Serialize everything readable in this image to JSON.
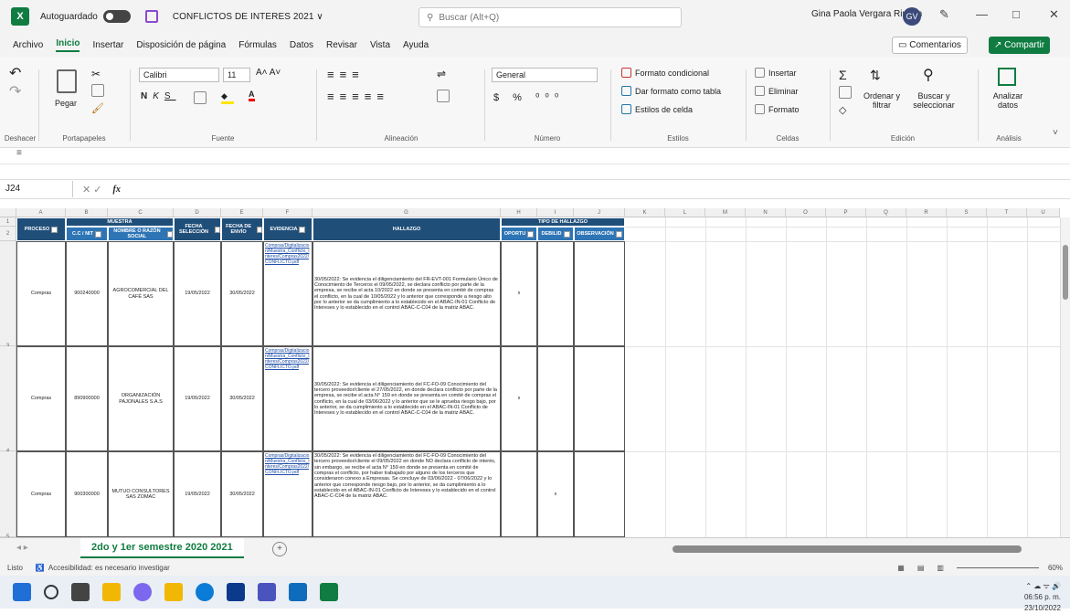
{
  "titlebar": {
    "autosave": "Autoguardado",
    "title": "CONFLICTOS DE INTERES 2021 ∨",
    "search": "Buscar (Alt+Q)",
    "user": "Gina Paola Vergara Rincon",
    "avatar": "GV",
    "minimize": "—",
    "maximize": "□",
    "close": "✕"
  },
  "menu": [
    "Archivo",
    "Inicio",
    "Insertar",
    "Disposición de página",
    "Fórmulas",
    "Datos",
    "Revisar",
    "Vista",
    "Ayuda"
  ],
  "menu_active": "Inicio",
  "buttons": {
    "comentarios": "Comentarios",
    "compartir": "Compartir"
  },
  "ribbon": {
    "deshacer": "Deshacer",
    "portapapeles": "Portapapeles",
    "pegar": "Pegar",
    "fuente": "Fuente",
    "font_name": "Calibri",
    "font_size": "11",
    "alineacion": "Alineación",
    "numero_format": "General",
    "numero": "Número",
    "formato_condicional": "Formato condicional",
    "dar_formato": "Dar formato como tabla",
    "estilos_celda": "Estilos de celda",
    "estilos": "Estilos",
    "insertar": "Insertar",
    "eliminar": "Eliminar",
    "formato": "Formato",
    "celdas": "Celdas",
    "ordenar": "Ordenar y filtrar",
    "buscar": "Buscar y seleccionar",
    "edicion": "Edición",
    "analizar": "Analizar datos",
    "analisis": "Análisis"
  },
  "formula_bar": {
    "namebox": "J24",
    "fx": "fx",
    "value": ""
  },
  "columns": [
    "A",
    "B",
    "C",
    "D",
    "E",
    "F",
    "G",
    "H",
    "I",
    "J",
    "K",
    "L",
    "M",
    "N",
    "O",
    "P",
    "Q",
    "R",
    "S",
    "T",
    "U"
  ],
  "table_header": {
    "muestra": "MUESTRA",
    "tipo_hallazgo": "TIPO DE HALLAZGO",
    "proceso": "PROCESO",
    "cc_nit": "C.C / NIT",
    "nombre": "NOMBRE O RAZÓN SOCIAL",
    "fecha_selec": "FECHA SELECCIÓN",
    "fecha_env": "FECHA DE ENVÍO",
    "evidencia": "EVIDENCIA",
    "hallazgo": "HALLAZGO",
    "oportunidad": "OPORTU",
    "debilidad": "DEBILID",
    "observacion": "OBSERVACIÓN"
  },
  "rows": [
    {
      "rownum": "3",
      "proceso": "Compras",
      "nit": "900240000",
      "nombre": "AGROCOMERCIAL DEL CAFÉ SAS",
      "fecha_selec": "19/05/2022",
      "fecha_env": "30/05/2022",
      "evidencia": "Compras/Digitalizacion/Muestra_Conflicto_Interes/Compras2022/CONFLICTO.pdf",
      "hallazgo": "30/05/2022: Se evidencia el diligenciamiento del FR-EVT-001 Formulario Único de Conocimiento de Terceros el 09/05/2022, se declara conflicto por parte de la empresa, se recibe el acta 10/2022 en donde se presenta en comité de compras el conflicto, en la cual de 10/05/2022 y lo anterior que corresponde a riesgo alto por lo anterior se da cumplimiento a lo establecido en el ABAC-IN-01 Conflicto de Intereses y lo establecido en el control ABAC-C-C04 de la matriz ABAC.",
      "x_col": "x",
      "x_pos": "oportunidad"
    },
    {
      "rownum": "4",
      "proceso": "Compras",
      "nit": "890900000",
      "nombre": "ORGANIZACIÓN PAJONALES S.A.S",
      "fecha_selec": "19/05/2022",
      "fecha_env": "30/05/2022",
      "evidencia": "Compras/Digitalizacion/Muestra_Conflicto_Interes/Compras2022/CONFLICTO.pdf",
      "hallazgo": "30/05/2022: Se evidencia el diligenciamiento del FC-FO-09 Conocimiento del tercero proveedor/cliente el 27/05/2022, en donde declara conflicto por parte de la empresa, se recibe el acta N° 159 en donde se presenta en comité de compras el conflicto, en la cual de 03/06/2022 y lo anterior que se le aprueba riesgo bajo, por lo anterior, se da cumplimiento a lo establecido en el ABAC-IN-01 Conflicto de Intereses y lo establecido en el control ABAC-C-C04 de la matriz ABAC.",
      "x_col": "x",
      "x_pos": "oportunidad"
    },
    {
      "rownum": "5",
      "proceso": "Compras",
      "nit": "900300000",
      "nombre": "MUTUO CONSULTORES SAS ZOMAC",
      "fecha_selec": "19/05/2022",
      "fecha_env": "30/05/2022",
      "evidencia": "Compras/Digitalizacion/Muestra_Conflicto_Interes/Compras2022/CONFLICTO.pdf",
      "hallazgo": "30/05/2022: Se evidencia el diligenciamiento del FC-FO-09 Conocimiento del tercero proveedor/cliente el 09/05/2022 en donde NO declara conflicto de interés, sin embargo, se recibe el acta N° 159 en donde se presenta en comité de compras el conflicto, por haber trabajado por alguno de los terceros que consideraron conexo a Empresas. Se concluye de 03/06/2022 - 07/06/2022 y lo anterior que corresponde riesgo bajo, por lo anterior, se da cumplimiento a lo establecido en el ABAC-IN-01 Conflicto de Intereses y lo establecido en el control ABAC-C-C04 de la matriz ABAC.",
      "x_col": "x",
      "x_pos": "debilidad"
    }
  ],
  "sheet_tab": "2do y 1er semestre 2020 2021",
  "add_sheet": "+",
  "status": {
    "ready": "Listo",
    "accessibility": "Accesibilidad: es necesario investigar",
    "zoom": "60%"
  },
  "tray": {
    "time": "06:56 p. m.",
    "date": "23/10/2022"
  }
}
